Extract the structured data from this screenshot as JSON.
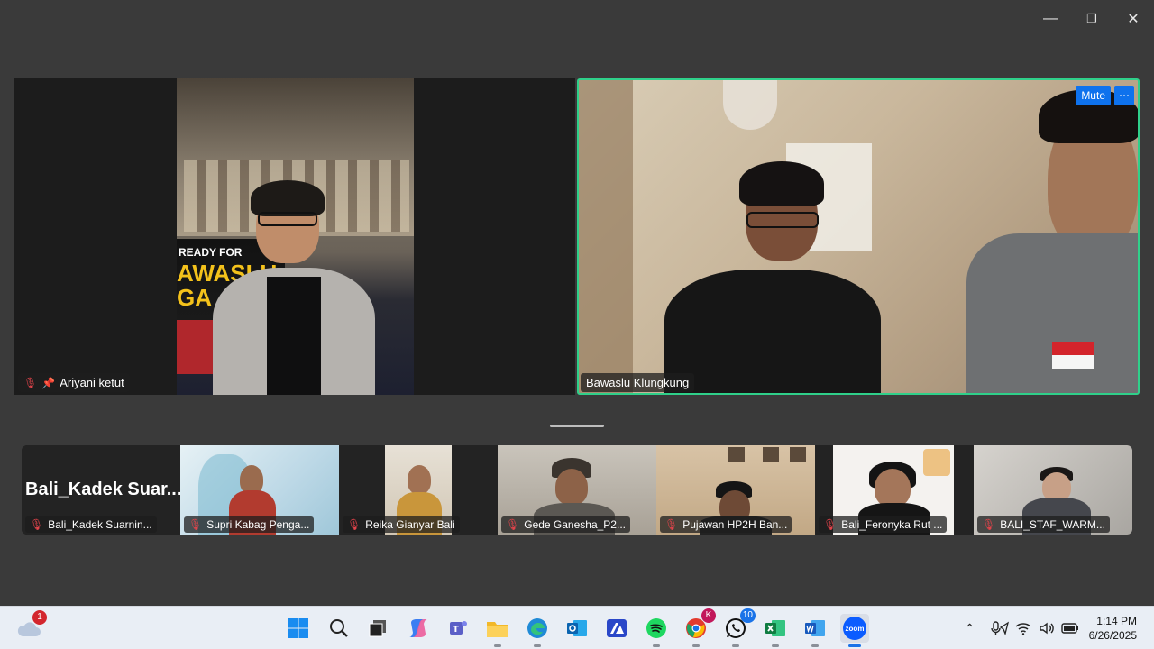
{
  "window": {
    "minimize_glyph": "—",
    "restore_glyph": "❐",
    "close_glyph": "✕"
  },
  "main_tiles": {
    "left": {
      "name": "Ariyani ketut",
      "banner_small": "READY FOR",
      "banner_big": "AWASLU",
      "banner_big2": "GA"
    },
    "right": {
      "name": "Bawaslu Klungkung",
      "mute_label": "Mute",
      "more_label": "···",
      "active_speaker_color": "#2fd08a"
    }
  },
  "gallery": [
    {
      "name": "Bali_Kadek Suarnin...",
      "display_text": "Bali_Kadek  Suar...",
      "video": false
    },
    {
      "name": "Supri Kabag Penga...",
      "video": true
    },
    {
      "name": "Reika Gianyar Bali",
      "video": true
    },
    {
      "name": "Gede Ganesha_P2...",
      "video": true
    },
    {
      "name": "Pujawan HP2H Ban...",
      "video": true
    },
    {
      "name": "Bali_Feronyka Rut ...",
      "video": true
    },
    {
      "name": "BALI_STAF_WARM...",
      "video": true
    }
  ],
  "taskbar": {
    "weather_badge": "1",
    "whatsapp_badge": "10",
    "chrome_badge": "K",
    "zoom_label": "zoom",
    "clock_time": "1:14 PM",
    "clock_date": "6/26/2025"
  },
  "colors": {
    "zoom_blue": "#0e72ed",
    "mic_off_red": "#e0434a",
    "taskbar_bg": "#e9eef5"
  }
}
